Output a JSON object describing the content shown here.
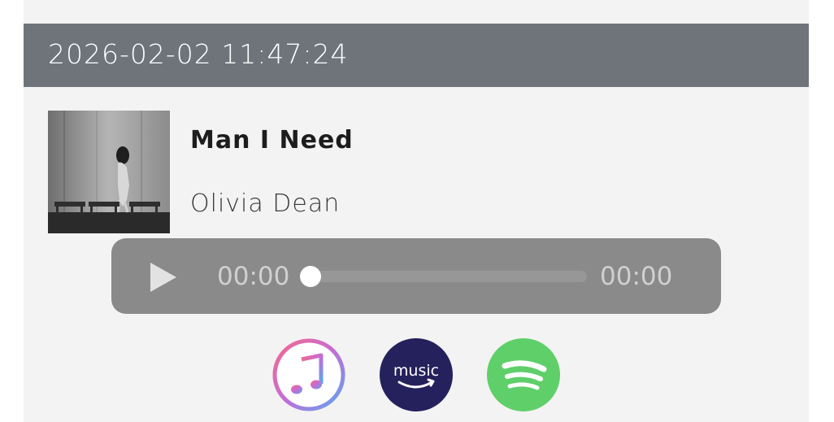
{
  "header": {
    "timestamp": "2026-02-02 11:47:24"
  },
  "track": {
    "title": "Man I Need",
    "artist": "Olivia Dean",
    "album_art_icon": "album-cover-image"
  },
  "player": {
    "play_icon": "play-icon",
    "current_time": "00:00",
    "total_time": "00:00",
    "progress_fraction": 0.0
  },
  "services": [
    {
      "name": "apple-music",
      "icon": "apple-music-icon"
    },
    {
      "name": "amazon-music",
      "label": "music",
      "icon": "amazon-music-icon"
    },
    {
      "name": "spotify",
      "icon": "spotify-icon"
    }
  ],
  "colors": {
    "header_bg": "#6f747b",
    "player_bg": "#8a8a8a",
    "amazon_bg": "#25215c",
    "spotify_bg": "#5fcf6a"
  }
}
